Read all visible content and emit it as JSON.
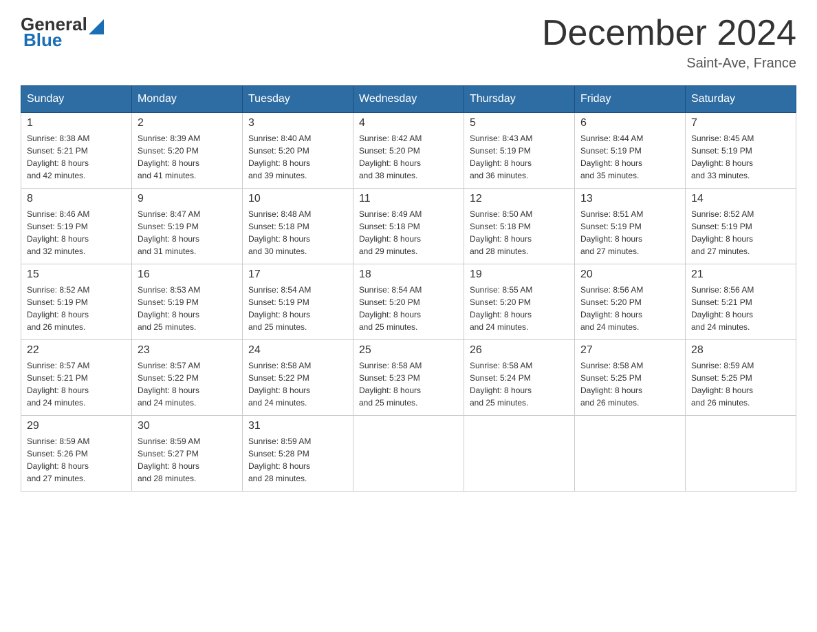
{
  "header": {
    "logo_general": "General",
    "logo_blue": "Blue",
    "title": "December 2024",
    "location": "Saint-Ave, France"
  },
  "calendar": {
    "weekdays": [
      "Sunday",
      "Monday",
      "Tuesday",
      "Wednesday",
      "Thursday",
      "Friday",
      "Saturday"
    ],
    "weeks": [
      [
        {
          "day": "1",
          "sunrise": "8:38 AM",
          "sunset": "5:21 PM",
          "daylight": "8 hours and 42 minutes."
        },
        {
          "day": "2",
          "sunrise": "8:39 AM",
          "sunset": "5:20 PM",
          "daylight": "8 hours and 41 minutes."
        },
        {
          "day": "3",
          "sunrise": "8:40 AM",
          "sunset": "5:20 PM",
          "daylight": "8 hours and 39 minutes."
        },
        {
          "day": "4",
          "sunrise": "8:42 AM",
          "sunset": "5:20 PM",
          "daylight": "8 hours and 38 minutes."
        },
        {
          "day": "5",
          "sunrise": "8:43 AM",
          "sunset": "5:19 PM",
          "daylight": "8 hours and 36 minutes."
        },
        {
          "day": "6",
          "sunrise": "8:44 AM",
          "sunset": "5:19 PM",
          "daylight": "8 hours and 35 minutes."
        },
        {
          "day": "7",
          "sunrise": "8:45 AM",
          "sunset": "5:19 PM",
          "daylight": "8 hours and 33 minutes."
        }
      ],
      [
        {
          "day": "8",
          "sunrise": "8:46 AM",
          "sunset": "5:19 PM",
          "daylight": "8 hours and 32 minutes."
        },
        {
          "day": "9",
          "sunrise": "8:47 AM",
          "sunset": "5:19 PM",
          "daylight": "8 hours and 31 minutes."
        },
        {
          "day": "10",
          "sunrise": "8:48 AM",
          "sunset": "5:18 PM",
          "daylight": "8 hours and 30 minutes."
        },
        {
          "day": "11",
          "sunrise": "8:49 AM",
          "sunset": "5:18 PM",
          "daylight": "8 hours and 29 minutes."
        },
        {
          "day": "12",
          "sunrise": "8:50 AM",
          "sunset": "5:18 PM",
          "daylight": "8 hours and 28 minutes."
        },
        {
          "day": "13",
          "sunrise": "8:51 AM",
          "sunset": "5:19 PM",
          "daylight": "8 hours and 27 minutes."
        },
        {
          "day": "14",
          "sunrise": "8:52 AM",
          "sunset": "5:19 PM",
          "daylight": "8 hours and 27 minutes."
        }
      ],
      [
        {
          "day": "15",
          "sunrise": "8:52 AM",
          "sunset": "5:19 PM",
          "daylight": "8 hours and 26 minutes."
        },
        {
          "day": "16",
          "sunrise": "8:53 AM",
          "sunset": "5:19 PM",
          "daylight": "8 hours and 25 minutes."
        },
        {
          "day": "17",
          "sunrise": "8:54 AM",
          "sunset": "5:19 PM",
          "daylight": "8 hours and 25 minutes."
        },
        {
          "day": "18",
          "sunrise": "8:54 AM",
          "sunset": "5:20 PM",
          "daylight": "8 hours and 25 minutes."
        },
        {
          "day": "19",
          "sunrise": "8:55 AM",
          "sunset": "5:20 PM",
          "daylight": "8 hours and 24 minutes."
        },
        {
          "day": "20",
          "sunrise": "8:56 AM",
          "sunset": "5:20 PM",
          "daylight": "8 hours and 24 minutes."
        },
        {
          "day": "21",
          "sunrise": "8:56 AM",
          "sunset": "5:21 PM",
          "daylight": "8 hours and 24 minutes."
        }
      ],
      [
        {
          "day": "22",
          "sunrise": "8:57 AM",
          "sunset": "5:21 PM",
          "daylight": "8 hours and 24 minutes."
        },
        {
          "day": "23",
          "sunrise": "8:57 AM",
          "sunset": "5:22 PM",
          "daylight": "8 hours and 24 minutes."
        },
        {
          "day": "24",
          "sunrise": "8:58 AM",
          "sunset": "5:22 PM",
          "daylight": "8 hours and 24 minutes."
        },
        {
          "day": "25",
          "sunrise": "8:58 AM",
          "sunset": "5:23 PM",
          "daylight": "8 hours and 25 minutes."
        },
        {
          "day": "26",
          "sunrise": "8:58 AM",
          "sunset": "5:24 PM",
          "daylight": "8 hours and 25 minutes."
        },
        {
          "day": "27",
          "sunrise": "8:58 AM",
          "sunset": "5:25 PM",
          "daylight": "8 hours and 26 minutes."
        },
        {
          "day": "28",
          "sunrise": "8:59 AM",
          "sunset": "5:25 PM",
          "daylight": "8 hours and 26 minutes."
        }
      ],
      [
        {
          "day": "29",
          "sunrise": "8:59 AM",
          "sunset": "5:26 PM",
          "daylight": "8 hours and 27 minutes."
        },
        {
          "day": "30",
          "sunrise": "8:59 AM",
          "sunset": "5:27 PM",
          "daylight": "8 hours and 28 minutes."
        },
        {
          "day": "31",
          "sunrise": "8:59 AM",
          "sunset": "5:28 PM",
          "daylight": "8 hours and 28 minutes."
        },
        null,
        null,
        null,
        null
      ]
    ],
    "labels": {
      "sunrise": "Sunrise:",
      "sunset": "Sunset:",
      "daylight": "Daylight:"
    }
  }
}
